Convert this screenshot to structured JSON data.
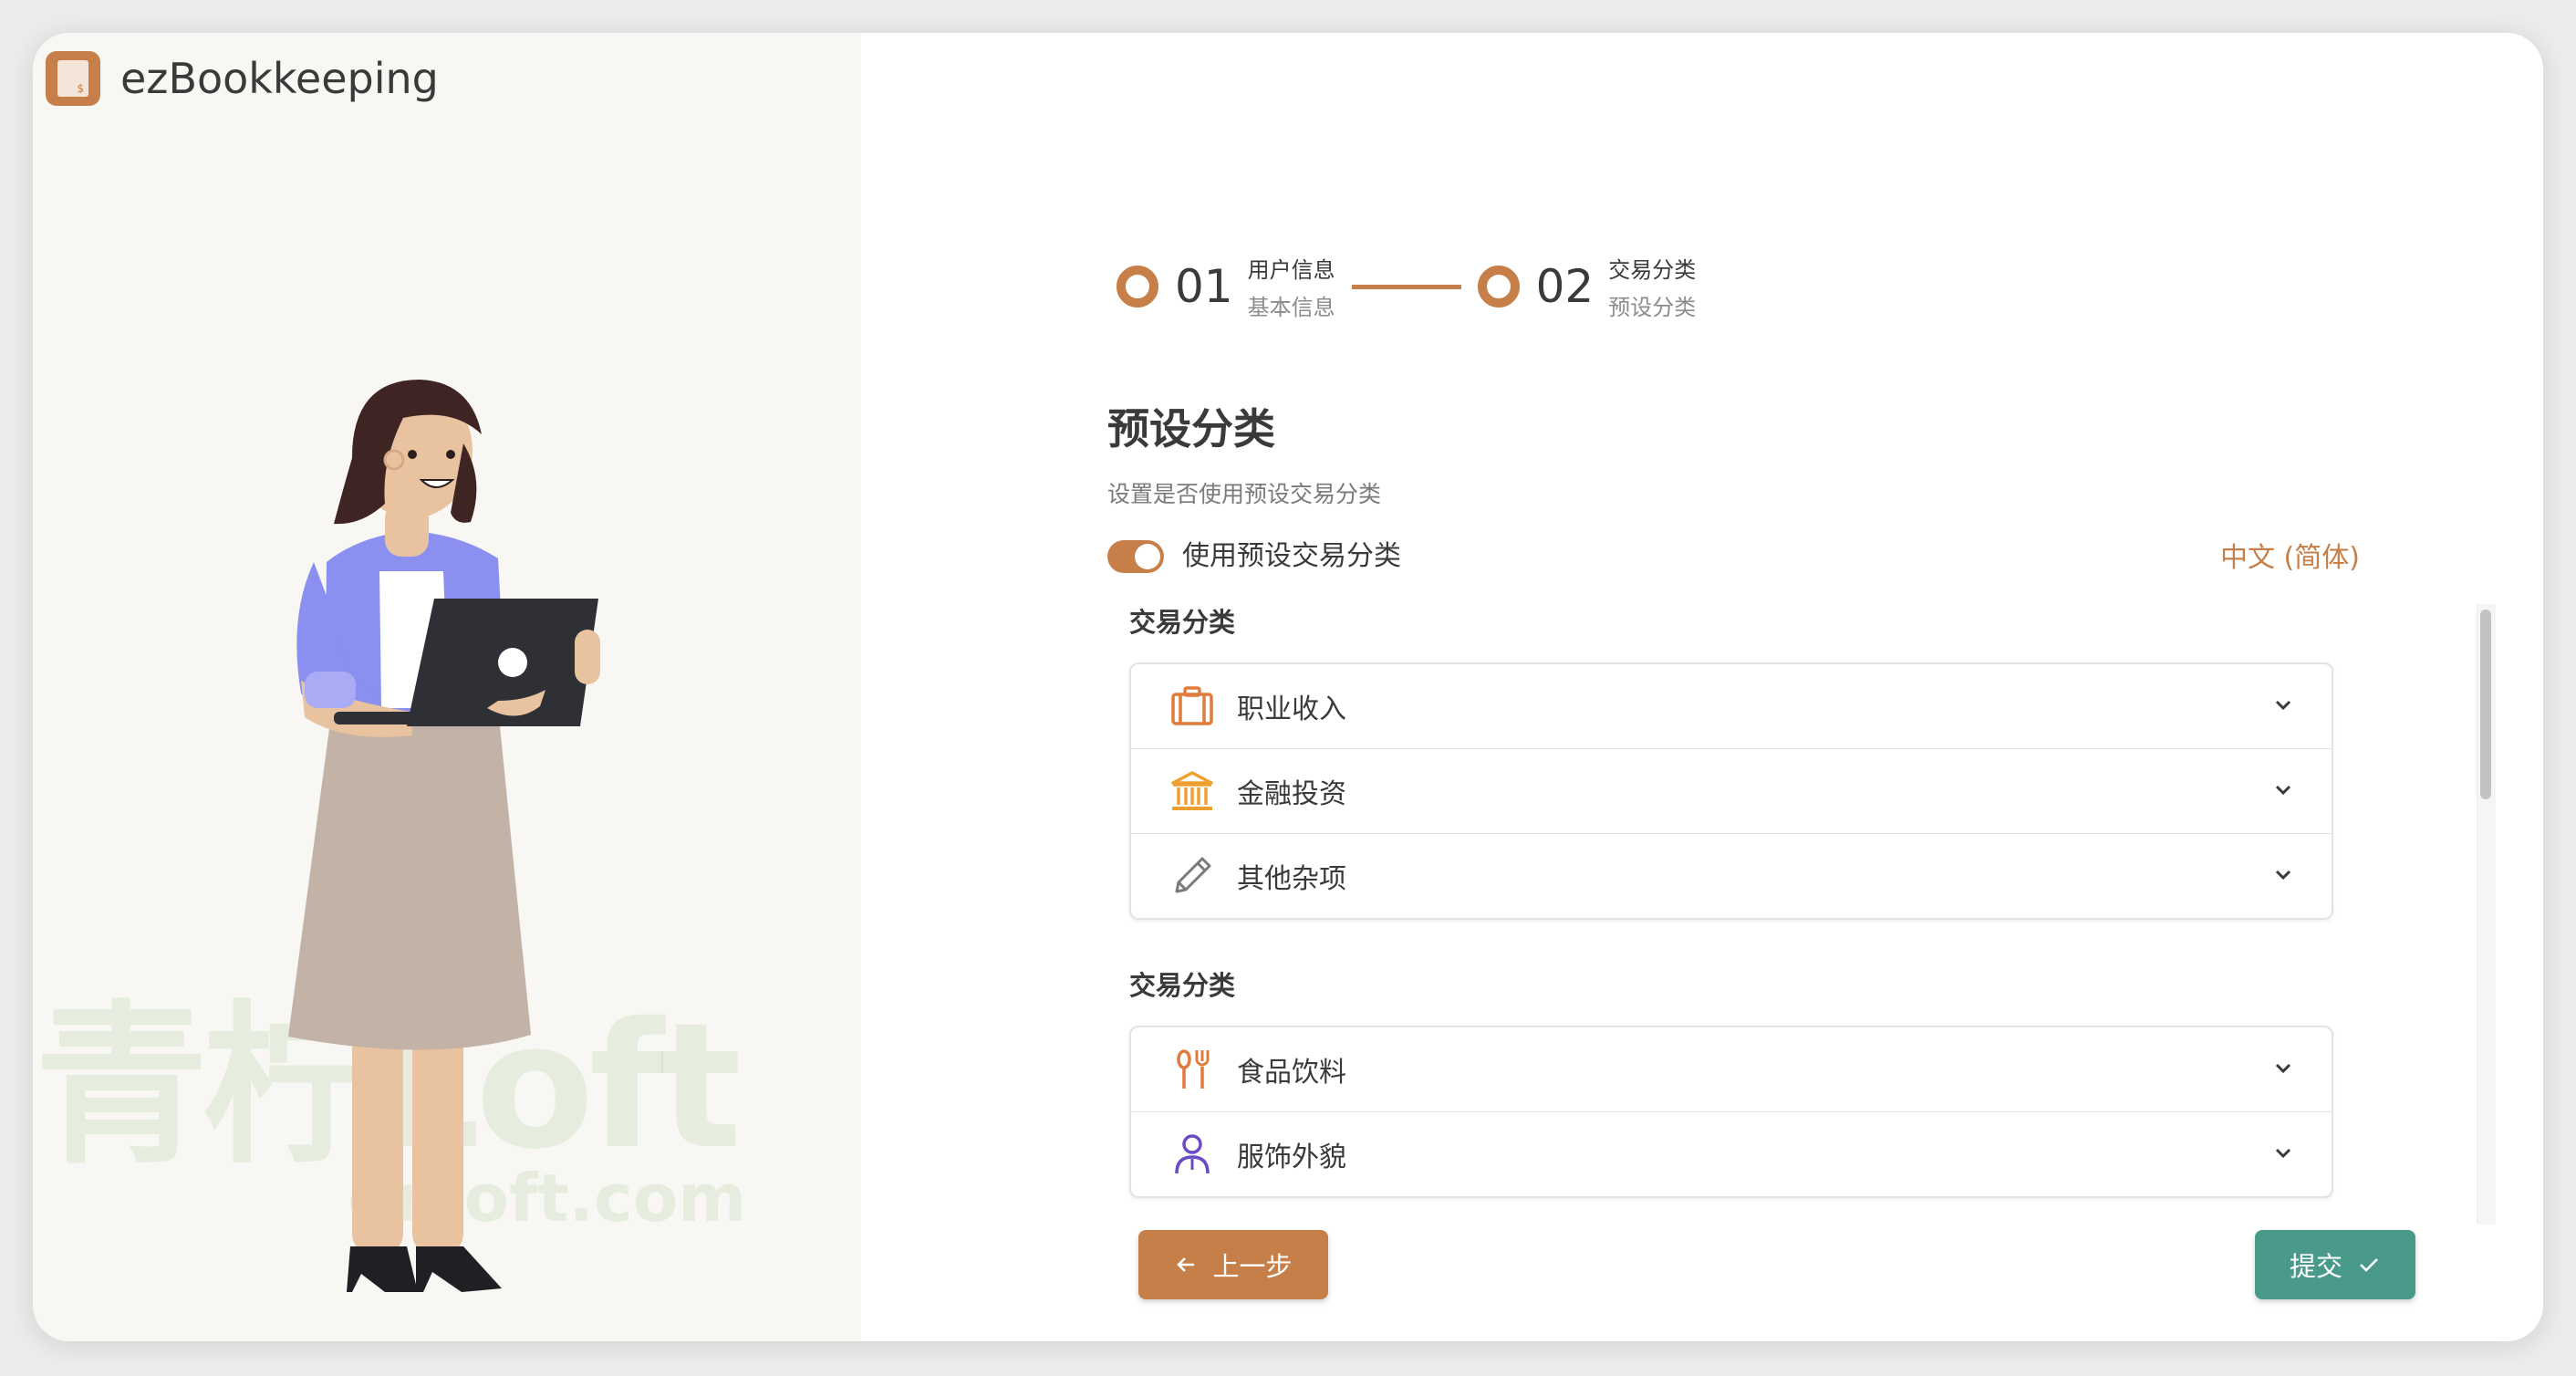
{
  "app": {
    "name": "ezBookkeeping"
  },
  "watermark": {
    "main": "青柠Loft",
    "sub": "qnloft.com"
  },
  "stepper": {
    "steps": [
      {
        "number": "01",
        "title": "用户信息",
        "subtitle": "基本信息"
      },
      {
        "number": "02",
        "title": "交易分类",
        "subtitle": "预设分类"
      }
    ]
  },
  "main": {
    "title": "预设分类",
    "subtitle": "设置是否使用预设交易分类",
    "toggle_label": "使用预设交易分类",
    "toggle_on": true,
    "language": "中文 (简体)"
  },
  "groups": [
    {
      "title": "交易分类",
      "items": [
        {
          "label": "职业收入",
          "icon": "briefcase-icon",
          "color": "#e07b3c"
        },
        {
          "label": "金融投资",
          "icon": "bank-icon",
          "color": "#f0a030"
        },
        {
          "label": "其他杂项",
          "icon": "pencil-icon",
          "color": "#7a7a7a"
        }
      ]
    },
    {
      "title": "交易分类",
      "items": [
        {
          "label": "食品饮料",
          "icon": "utensils-icon",
          "color": "#e07b3c"
        },
        {
          "label": "服饰外貌",
          "icon": "person-icon",
          "color": "#6a4bc4"
        }
      ]
    }
  ],
  "buttons": {
    "back": "上一步",
    "submit": "提交"
  },
  "colors": {
    "accent": "#c67f48",
    "submit": "#4a9a8c"
  }
}
